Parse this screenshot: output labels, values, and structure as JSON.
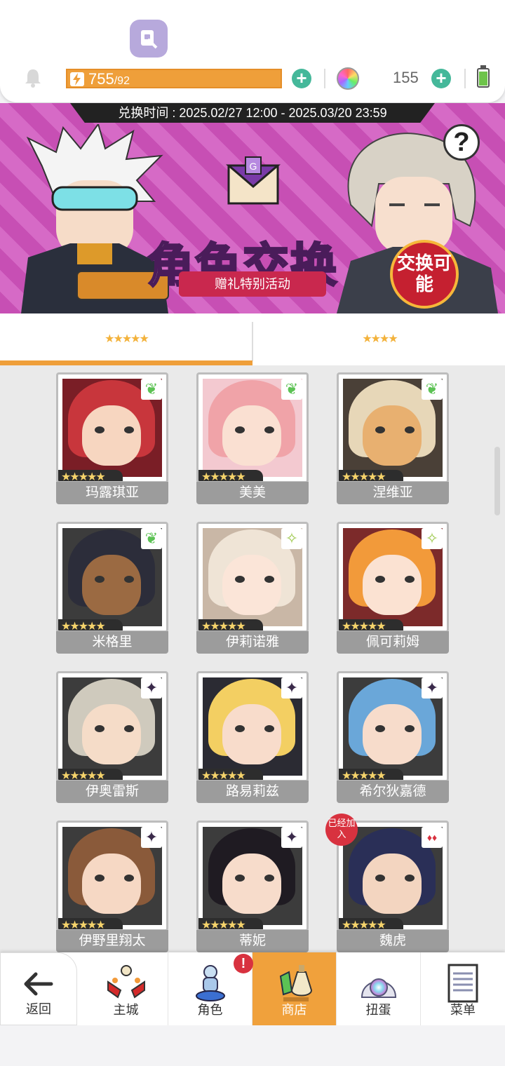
{
  "status": {
    "energy_value": "755",
    "energy_max": "/92",
    "gem_count": "155"
  },
  "banner": {
    "exchange_time": "兑换时间 : 2025.02/27 12:00 - 2025.03/20 23:59",
    "title": "角色交换",
    "subtitle": "赠礼特别活动",
    "seal_text": "交换可能",
    "help": "?"
  },
  "tabs": [
    {
      "label": "★★★★★"
    },
    {
      "label": "★★★★"
    }
  ],
  "characters": [
    {
      "name": "玛露琪亚",
      "element": "leaf-icon",
      "stars": "★★★★★",
      "hair": "#c8363c",
      "skin": "#f7d6c0",
      "bg": "#7a1e26"
    },
    {
      "name": "美美",
      "element": "leaf-icon",
      "stars": "★★★★★",
      "hair": "#f0a3a8",
      "skin": "#fae0d2",
      "bg": "#f3c9d0"
    },
    {
      "name": "涅维亚",
      "element": "leaf-icon",
      "stars": "★★★★★",
      "hair": "#e7d7b8",
      "skin": "#e8b070",
      "bg": "#4a4037"
    },
    {
      "name": "米格里",
      "element": "leaf-icon",
      "stars": "★★★★★",
      "hair": "#2c2d3a",
      "skin": "#9b6a42",
      "bg": "#3c3c3c"
    },
    {
      "name": "伊莉诺雅",
      "element": "sparkle-icon",
      "stars": "★★★★★",
      "hair": "#efe4d6",
      "skin": "#fbe5d8",
      "bg": "#c9b7a6"
    },
    {
      "name": "佩可莉姆",
      "element": "sparkle-icon",
      "stars": "★★★★★",
      "hair": "#f29a3a",
      "skin": "#fbe2d2",
      "bg": "#7c2a2a"
    },
    {
      "name": "伊奥雷斯",
      "element": "dark-star-icon",
      "stars": "★★★★★",
      "hair": "#cfcabd",
      "skin": "#f5dcc8",
      "bg": "#3c3c3c"
    },
    {
      "name": "路易莉兹",
      "element": "dark-star-icon",
      "stars": "★★★★★",
      "hair": "#f3cf62",
      "skin": "#f8dccb",
      "bg": "#2b2b33"
    },
    {
      "name": "希尔狄嘉德",
      "element": "dark-star-icon",
      "stars": "★★★★★",
      "hair": "#6aa7d9",
      "skin": "#f7dccb",
      "bg": "#3c3c3c"
    },
    {
      "name": "伊野里翔太",
      "element": "dark-star-icon",
      "stars": "★★★★★",
      "hair": "#8a5a3a",
      "skin": "#f6d8c4",
      "bg": "#3c3c3c"
    },
    {
      "name": "蒂妮",
      "element": "dark-star-icon",
      "stars": "★★★★★",
      "hair": "#1f1b22",
      "skin": "#f7dccb",
      "bg": "#3c3c3c"
    },
    {
      "name": "魏虎",
      "element": "fire-icon",
      "stars": "★★★★★",
      "hair": "#2a2f57",
      "skin": "#f3d5c0",
      "bg": "#3c3c3c",
      "joined": "已经加入"
    }
  ],
  "nav": {
    "back": "返回",
    "main_city": "主城",
    "character": "角色",
    "shop": "商店",
    "gacha": "扭蛋",
    "menu": "菜单",
    "alert": "!"
  },
  "colors": {
    "accent": "#ef9f3a",
    "plus": "#45b89a",
    "banner_pink": "#c74fb4",
    "badge_red": "#d8323f"
  }
}
